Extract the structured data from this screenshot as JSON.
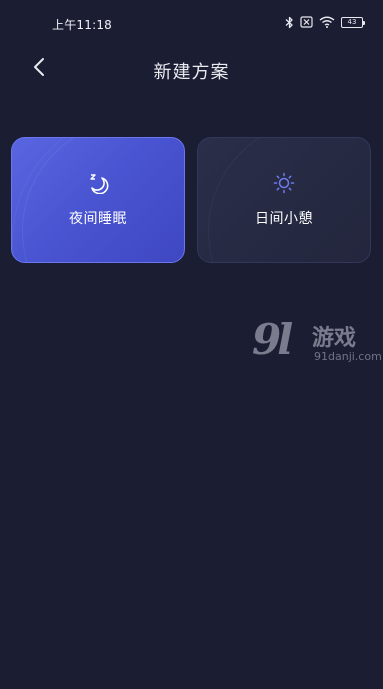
{
  "status_bar": {
    "time": "上午11:18",
    "battery": "43",
    "icons": [
      "bluetooth-icon",
      "sim-off-icon",
      "wifi-icon",
      "battery-icon"
    ]
  },
  "header": {
    "title": "新建方案",
    "back_icon": "chevron-left-icon"
  },
  "plans": [
    {
      "label": "夜间睡眠",
      "icon": "moon-zzz-icon",
      "selected": true
    },
    {
      "label": "日间小憩",
      "icon": "sun-icon",
      "selected": false
    }
  ],
  "watermark": {
    "logo": "9l",
    "text": "游戏",
    "url": "91danji.com"
  },
  "colors": {
    "background": "#1b1d33",
    "selected_card": "#4a55d2",
    "card": "#252941"
  }
}
